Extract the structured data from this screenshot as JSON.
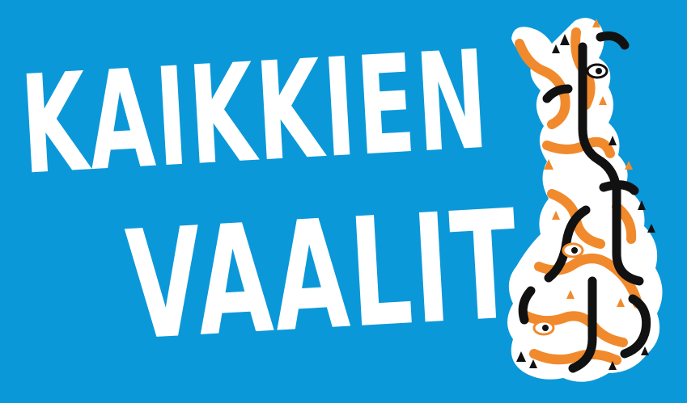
{
  "title": {
    "line1": "KAIKKIEN",
    "line2": "VAALIT"
  },
  "colors": {
    "background": "#0b98d8",
    "text": "#ffffff",
    "accent_orange": "#f08a2c",
    "accent_black": "#111111",
    "map_fill": "#ffffff"
  },
  "illustration": {
    "icon": "finland-map-illustration-icon"
  }
}
